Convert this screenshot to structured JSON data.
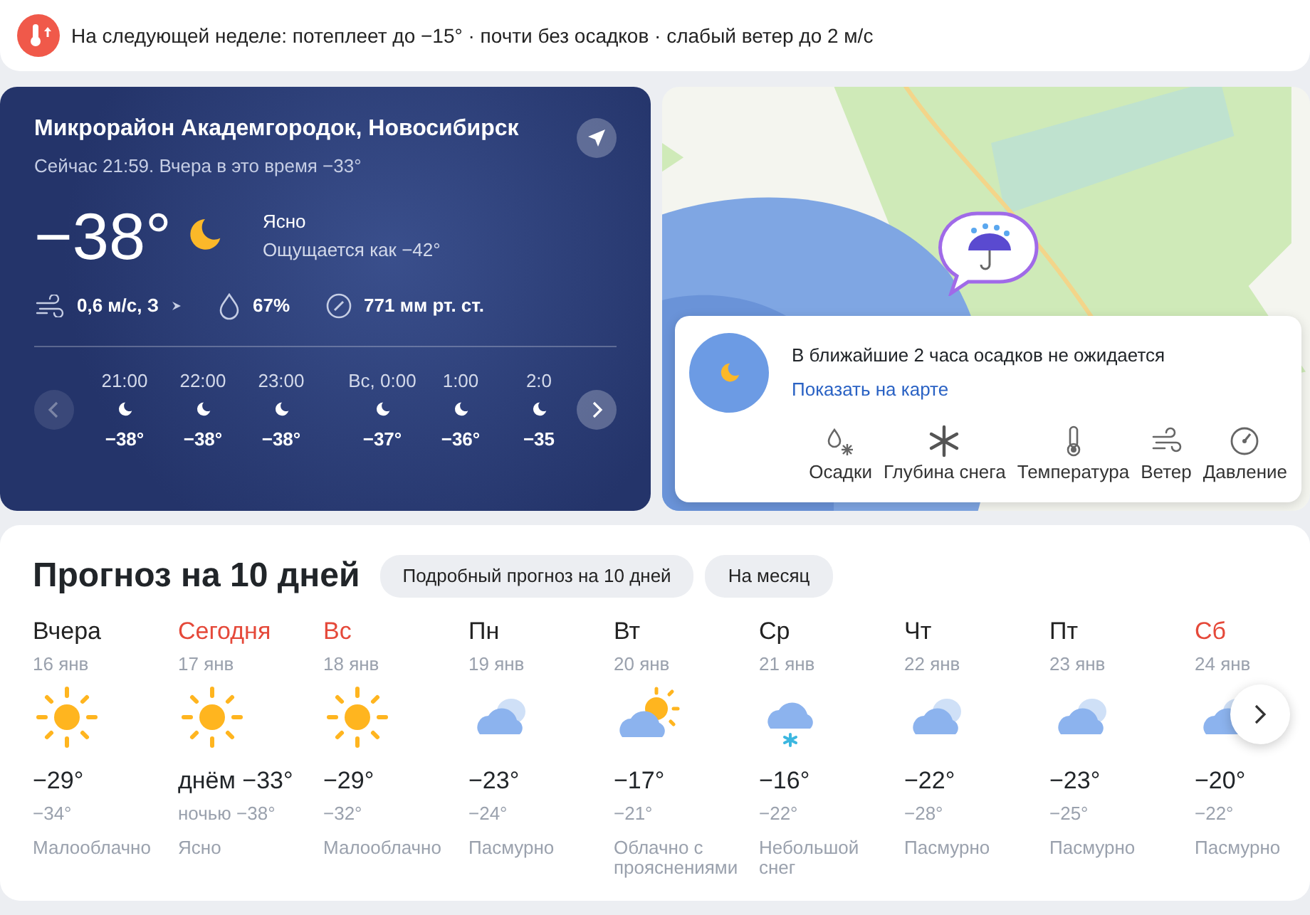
{
  "banner": {
    "text": "На следующей неделе: потеплеет до −15° · почти без осадков · слабый ветер до 2 м/с"
  },
  "now": {
    "location": "Микрорайон Академгородок, Новосибирск",
    "subtitle": "Сейчас 21:59. Вчера в это время −33°",
    "temp": "−38°",
    "condition": "Ясно",
    "feels": "Ощущается как −42°",
    "wind": "0,6 м/с, З",
    "humidity": "67%",
    "pressure": "771 мм рт. ст.",
    "prev_disabled": true,
    "hours": [
      {
        "time": "21:00",
        "temp": "−38°",
        "new_day": false
      },
      {
        "time": "22:00",
        "temp": "−38°",
        "new_day": false
      },
      {
        "time": "23:00",
        "temp": "−38°",
        "new_day": false
      },
      {
        "time": "Вс, 0:00",
        "temp": "−37°",
        "new_day": true
      },
      {
        "time": "1:00",
        "temp": "−36°",
        "new_day": false
      },
      {
        "time": "2:0",
        "temp": "−35",
        "new_day": false
      }
    ]
  },
  "map": {
    "kind": "picture",
    "nowcast": "В ближайшие 2 часа осадков не ожидается",
    "link": "Показать на карте",
    "layers": [
      {
        "label": "Осадки",
        "kind": "precip"
      },
      {
        "label": "Глубина снега",
        "kind": "snow"
      },
      {
        "label": "Температура",
        "kind": "temp"
      },
      {
        "label": "Ветер",
        "kind": "wind"
      },
      {
        "label": "Давление",
        "kind": "pressure"
      }
    ]
  },
  "forecast": {
    "title": "Прогноз на 10 дней",
    "buttons": [
      "Подробный прогноз на 10 дней",
      "На месяц"
    ],
    "days": [
      {
        "name": "Вчера",
        "date": "16 янв",
        "kind": "sun",
        "day": "−29°",
        "night": "−34°",
        "condition": "Малооблачно",
        "weekend": false,
        "week_break": false
      },
      {
        "name": "Сегодня",
        "date": "17 янв",
        "kind": "sun",
        "day": "днём −33°",
        "night": "ночью −38°",
        "condition": "Ясно",
        "weekend": true,
        "week_break": false
      },
      {
        "name": "Вс",
        "date": "18 янв",
        "kind": "sun",
        "day": "−29°",
        "night": "−32°",
        "condition": "Малооблачно",
        "weekend": true,
        "week_break": false
      },
      {
        "name": "Пн",
        "date": "19 янв",
        "kind": "cloud",
        "day": "−23°",
        "night": "−24°",
        "condition": "Пасмурно",
        "weekend": false,
        "week_break": true
      },
      {
        "name": "Вт",
        "date": "20 янв",
        "kind": "partly",
        "day": "−17°",
        "night": "−21°",
        "condition": "Облачно с прояснениями",
        "weekend": false,
        "week_break": false
      },
      {
        "name": "Ср",
        "date": "21 янв",
        "kind": "snow",
        "day": "−16°",
        "night": "−22°",
        "condition": "Небольшой снег",
        "weekend": false,
        "week_break": false
      },
      {
        "name": "Чт",
        "date": "22 янв",
        "kind": "cloud",
        "day": "−22°",
        "night": "−28°",
        "condition": "Пасмурно",
        "weekend": false,
        "week_break": false
      },
      {
        "name": "Пт",
        "date": "23 янв",
        "kind": "cloud",
        "day": "−23°",
        "night": "−25°",
        "condition": "Пасмурно",
        "weekend": false,
        "week_break": false
      },
      {
        "name": "Сб",
        "date": "24 янв",
        "kind": "cloud",
        "day": "−20°",
        "night": "−22°",
        "condition": "Пасмурно",
        "weekend": true,
        "week_break": false
      }
    ]
  }
}
